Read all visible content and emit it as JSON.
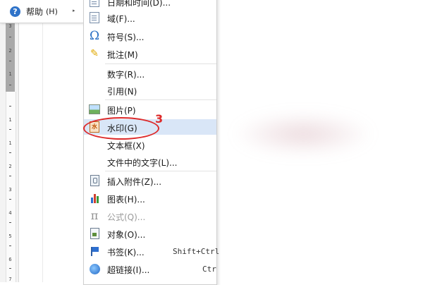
{
  "parent_menu": {
    "help_label": "帮助",
    "help_shortcut": "(H)",
    "help_icon": "?",
    "arrow": "▸"
  },
  "ruler": {
    "ticks": [
      "3",
      "2",
      "1",
      "1",
      "1",
      "2",
      "3",
      "4",
      "5",
      "6",
      "7"
    ]
  },
  "submenu": {
    "items": [
      {
        "icon": "date-icon",
        "label": "日期和时间(D)..."
      },
      {
        "icon": "field-icon",
        "label": "域(F)..."
      },
      {
        "icon": "omega-icon",
        "glyph": "Ω",
        "label": "符号(S)..."
      },
      {
        "icon": "comment-icon",
        "glyph": "✎",
        "label": "批注(M)"
      },
      {
        "label": "数字(R)..."
      },
      {
        "label": "引用(N)"
      },
      {
        "icon": "picture-icon",
        "label": "图片(P)"
      },
      {
        "icon": "watermark-icon",
        "glyph": "水",
        "label": "水印(G)"
      },
      {
        "label": "文本框(X)"
      },
      {
        "label": "文件中的文字(L)..."
      },
      {
        "icon": "attachment-icon",
        "label": "插入附件(Z)..."
      },
      {
        "icon": "chart-icon",
        "label": "图表(H)..."
      },
      {
        "icon": "formula-icon",
        "glyph": "π",
        "label": "公式(Q)...",
        "disabled": true
      },
      {
        "icon": "object-icon",
        "label": "对象(O)..."
      },
      {
        "icon": "bookmark-icon",
        "label": "书签(K)...",
        "shortcut": "Shift+Ctrl"
      },
      {
        "icon": "hyperlink-icon",
        "label": "超链接(I)...",
        "shortcut": "Ctr"
      }
    ],
    "highlighted_index": 7
  },
  "annotation": {
    "number": "3",
    "color": "#dd2a2a"
  },
  "colors": {
    "highlight": "#d9e6f7",
    "accent": "#2f73c9"
  }
}
